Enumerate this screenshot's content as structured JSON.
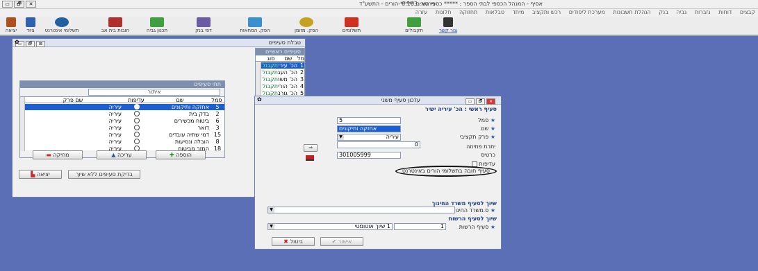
{
  "app": {
    "title": "אסיף - המנהל הכספי לבתי הספר : ***** כספי הורים *****-הורים - התשע\"ד",
    "version": "גירסא: 6.163",
    "win_btns": [
      "▭",
      "🗗",
      "✕"
    ]
  },
  "menu": [
    "קבצים",
    "דוחות",
    "גזברות",
    "גביה",
    "בנק",
    "הנהלת חשבונות",
    "מערכת ליסודים",
    "רכש ותקציב",
    "מיחד",
    "טבלאות",
    "תחזוקה",
    "חלונות",
    "עזרה"
  ],
  "toolbar": {
    "items": [
      "יציאה",
      "ציוד",
      "תשלומי אינטרנט",
      "חובות בית אב",
      "תכנון גביה",
      "דפי בנק",
      "הפק. המחאות",
      "הפק. מזומן",
      "תשלומים",
      "תקבולים",
      "צור קשר"
    ],
    "colors": [
      "#b05020",
      "#3060b0",
      "#2060a0",
      "#b03030",
      "#40a040",
      "#6b5aa5",
      "#3a8fd0",
      "#c8a020",
      "#d03020",
      "#40a040",
      "#333333"
    ]
  },
  "main_window": {
    "title": "טבלת סעיפים",
    "btns": [
      "▭",
      "🗗",
      "⊠"
    ],
    "main_panel": {
      "header": "סעיפים ראשיים",
      "cols": [
        "סמל",
        "שם",
        "סוג"
      ],
      "rows": [
        {
          "num": "1",
          "name": "הכ' עיריה ישיר",
          "type": "תקבולים"
        },
        {
          "num": "2",
          "name": "הכ' העברות ממשל",
          "type": "תקבולים"
        },
        {
          "num": "3",
          "name": "הכ' משרד חינוך",
          "type": "תקבולים"
        },
        {
          "num": "4",
          "name": "הכ' הורים",
          "type": "תקבולים"
        },
        {
          "num": "5",
          "name": "הכ' גורם אחר",
          "type": "תקבולים"
        }
      ]
    },
    "sub_panel": {
      "header": "תתי סעיפים",
      "filter_label": "איתור",
      "cols": [
        "סמל",
        "שם",
        "עדיפות",
        "שם פרק"
      ],
      "rows": [
        {
          "num": "5",
          "name": "אחזקה ותיקונים",
          "cat": "עיריה"
        },
        {
          "num": "2",
          "name": "בדק בית",
          "cat": "עיריה"
        },
        {
          "num": "6",
          "name": "ביטוח מכשירים",
          "cat": "עיריה"
        },
        {
          "num": "3",
          "name": "דואר",
          "cat": "עיריה"
        },
        {
          "num": "15",
          "name": "דמי שתיה עובדים",
          "cat": "עיריה"
        },
        {
          "num": "8",
          "name": "הובלה ונסיעות",
          "cat": "עיריה"
        },
        {
          "num": "18",
          "name": "החזר מביטוח",
          "cat": "עיריה"
        }
      ]
    },
    "buttons": {
      "add": "הוספה",
      "edit": "עריכה",
      "delete": "מחיקה",
      "check": "בדיקת סעיפים ללא שיוך",
      "exit": "יציאה"
    }
  },
  "dialog": {
    "title": "עדכון סעיף משני",
    "btns": [
      "▭",
      "🗗",
      "✕"
    ],
    "main_section": "סעיף ראשי : הכ' עיריה ישיר",
    "labels": {
      "symbol": "סמל",
      "name": "שם",
      "budget": "פרק תקציבי",
      "open_balance": "יתרת פתיחה",
      "card": "כרטיס",
      "priority": "עדיפות",
      "parent_debt": "סעיף חובה בתשלומי הורים באינטרנט"
    },
    "values": {
      "symbol": "5",
      "name": "אחזקה ותיקונים",
      "budget": "עיריה",
      "open_balance": "0",
      "card": "301005999"
    },
    "ministry_section": "שיוך לסעיף משרד החינוך",
    "ministry_label": "ס.משרד החינוך",
    "authority_section": "שיוך לסעיף הרשות",
    "authority_label": "סעיף הרשות",
    "authority_num": "1",
    "authority_value": "1 שיוך אוטומטי",
    "ok": "אישור",
    "cancel": "ביטול"
  }
}
